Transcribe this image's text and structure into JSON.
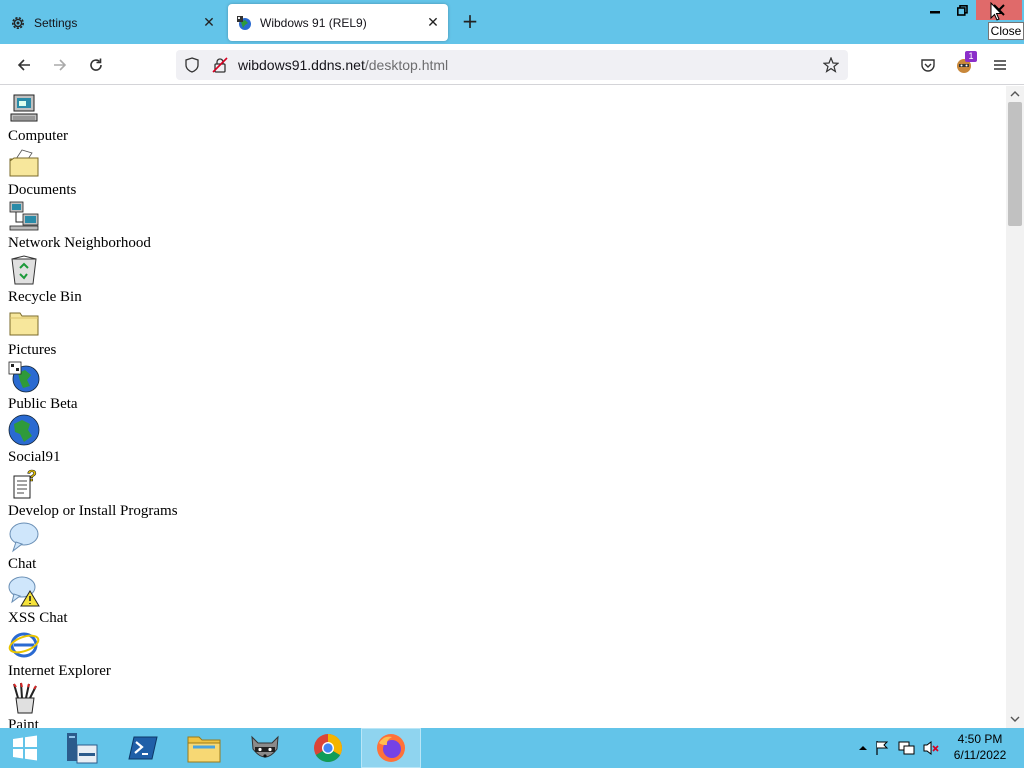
{
  "browser": {
    "tabs": [
      {
        "label": "Settings",
        "icon": "gear-icon",
        "active": false
      },
      {
        "label": "Wibdows 91 (REL9)",
        "icon": "site-favicon",
        "active": true
      }
    ],
    "new_tab_icon": "plus-icon",
    "window_controls": {
      "close_tooltip": "Close"
    },
    "url": {
      "host": "wibdows91.ddns.net",
      "path": "/desktop.html"
    },
    "extension_badge": "1"
  },
  "desktop": {
    "items": [
      {
        "label": "Computer",
        "icon": "computer-icon"
      },
      {
        "label": "Documents",
        "icon": "documents-folder-icon"
      },
      {
        "label": "Network Neighborhood",
        "icon": "network-icon"
      },
      {
        "label": "Recycle Bin",
        "icon": "recycle-bin-icon"
      },
      {
        "label": "Pictures",
        "icon": "pictures-folder-icon"
      },
      {
        "label": "Public Beta",
        "icon": "public-beta-icon"
      },
      {
        "label": "Social91",
        "icon": "globe-icon"
      },
      {
        "label": "Develop or Install Programs",
        "icon": "develop-programs-icon"
      },
      {
        "label": "Chat",
        "icon": "chat-bubble-icon"
      },
      {
        "label": "XSS Chat",
        "icon": "xss-chat-icon"
      },
      {
        "label": "Internet Explorer",
        "icon": "internet-explorer-icon"
      },
      {
        "label": "Paint",
        "icon": "paint-icon"
      }
    ]
  },
  "taskbar": {
    "apps": [
      "start-icon",
      "file-explorer-icon",
      "powershell-icon",
      "folder-icon",
      "raccoon-icon",
      "chrome-icon",
      "firefox-icon"
    ],
    "clock": {
      "time": "4:50 PM",
      "date": "6/11/2022"
    }
  },
  "colors": {
    "accent": "#63c4e9",
    "close_hover": "#e06a6a"
  }
}
